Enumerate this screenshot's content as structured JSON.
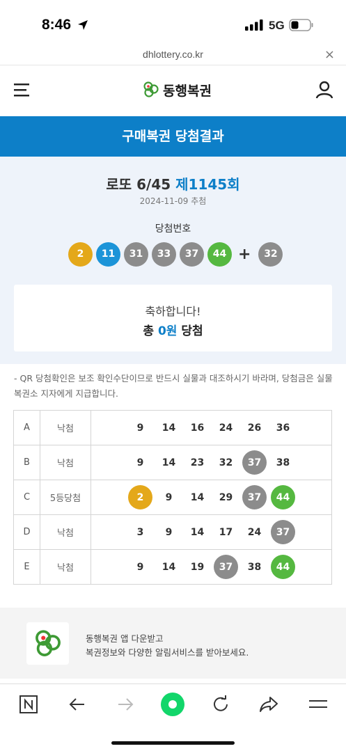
{
  "status": {
    "time": "8:46",
    "network": "5G"
  },
  "browser": {
    "url": "dhlottery.co.kr",
    "close": "×"
  },
  "header": {
    "logo_text": "동행복권"
  },
  "page_title": "구매복권 당첨결과",
  "draw": {
    "game": "로또 6/45",
    "round": "제1145회",
    "date": "2024-11-09 추첨",
    "winning_label": "당첨번호",
    "numbers": [
      "2",
      "11",
      "31",
      "33",
      "37",
      "44"
    ],
    "plus": "+",
    "bonus": "32"
  },
  "result": {
    "congrats": "축하합니다!",
    "total_prefix": "총",
    "total_amount": "0원",
    "total_suffix": "당첨"
  },
  "notice": "- QR 당첨확인은 보조 확인수단이므로 반드시 실물과 대조하시기 바라며, 당첨금은 실물 복권소 지자에게 지급합니다.",
  "tickets": [
    {
      "game": "A",
      "result": "낙첨",
      "numbers": [
        "9",
        "14",
        "16",
        "24",
        "26",
        "36"
      ]
    },
    {
      "game": "B",
      "result": "낙첨",
      "numbers": [
        "9",
        "14",
        "23",
        "32",
        "37",
        "38"
      ]
    },
    {
      "game": "C",
      "result": "5등당첨",
      "numbers": [
        "2",
        "9",
        "14",
        "29",
        "37",
        "44"
      ]
    },
    {
      "game": "D",
      "result": "낙첨",
      "numbers": [
        "3",
        "9",
        "14",
        "17",
        "24",
        "37"
      ]
    },
    {
      "game": "E",
      "result": "낙첨",
      "numbers": [
        "9",
        "14",
        "19",
        "37",
        "38",
        "44"
      ]
    }
  ],
  "app_banner": {
    "line1": "동행복권 앱 다운받고",
    "line2": "복권정보와 다양한 알림서비스를 받아보세요."
  },
  "colors": {
    "brand_blue": "#0d7fc8",
    "ball_yellow": "#e4a81a",
    "ball_blue": "#1c94d8",
    "ball_gray": "#8c8c8c",
    "ball_green": "#55b840"
  }
}
